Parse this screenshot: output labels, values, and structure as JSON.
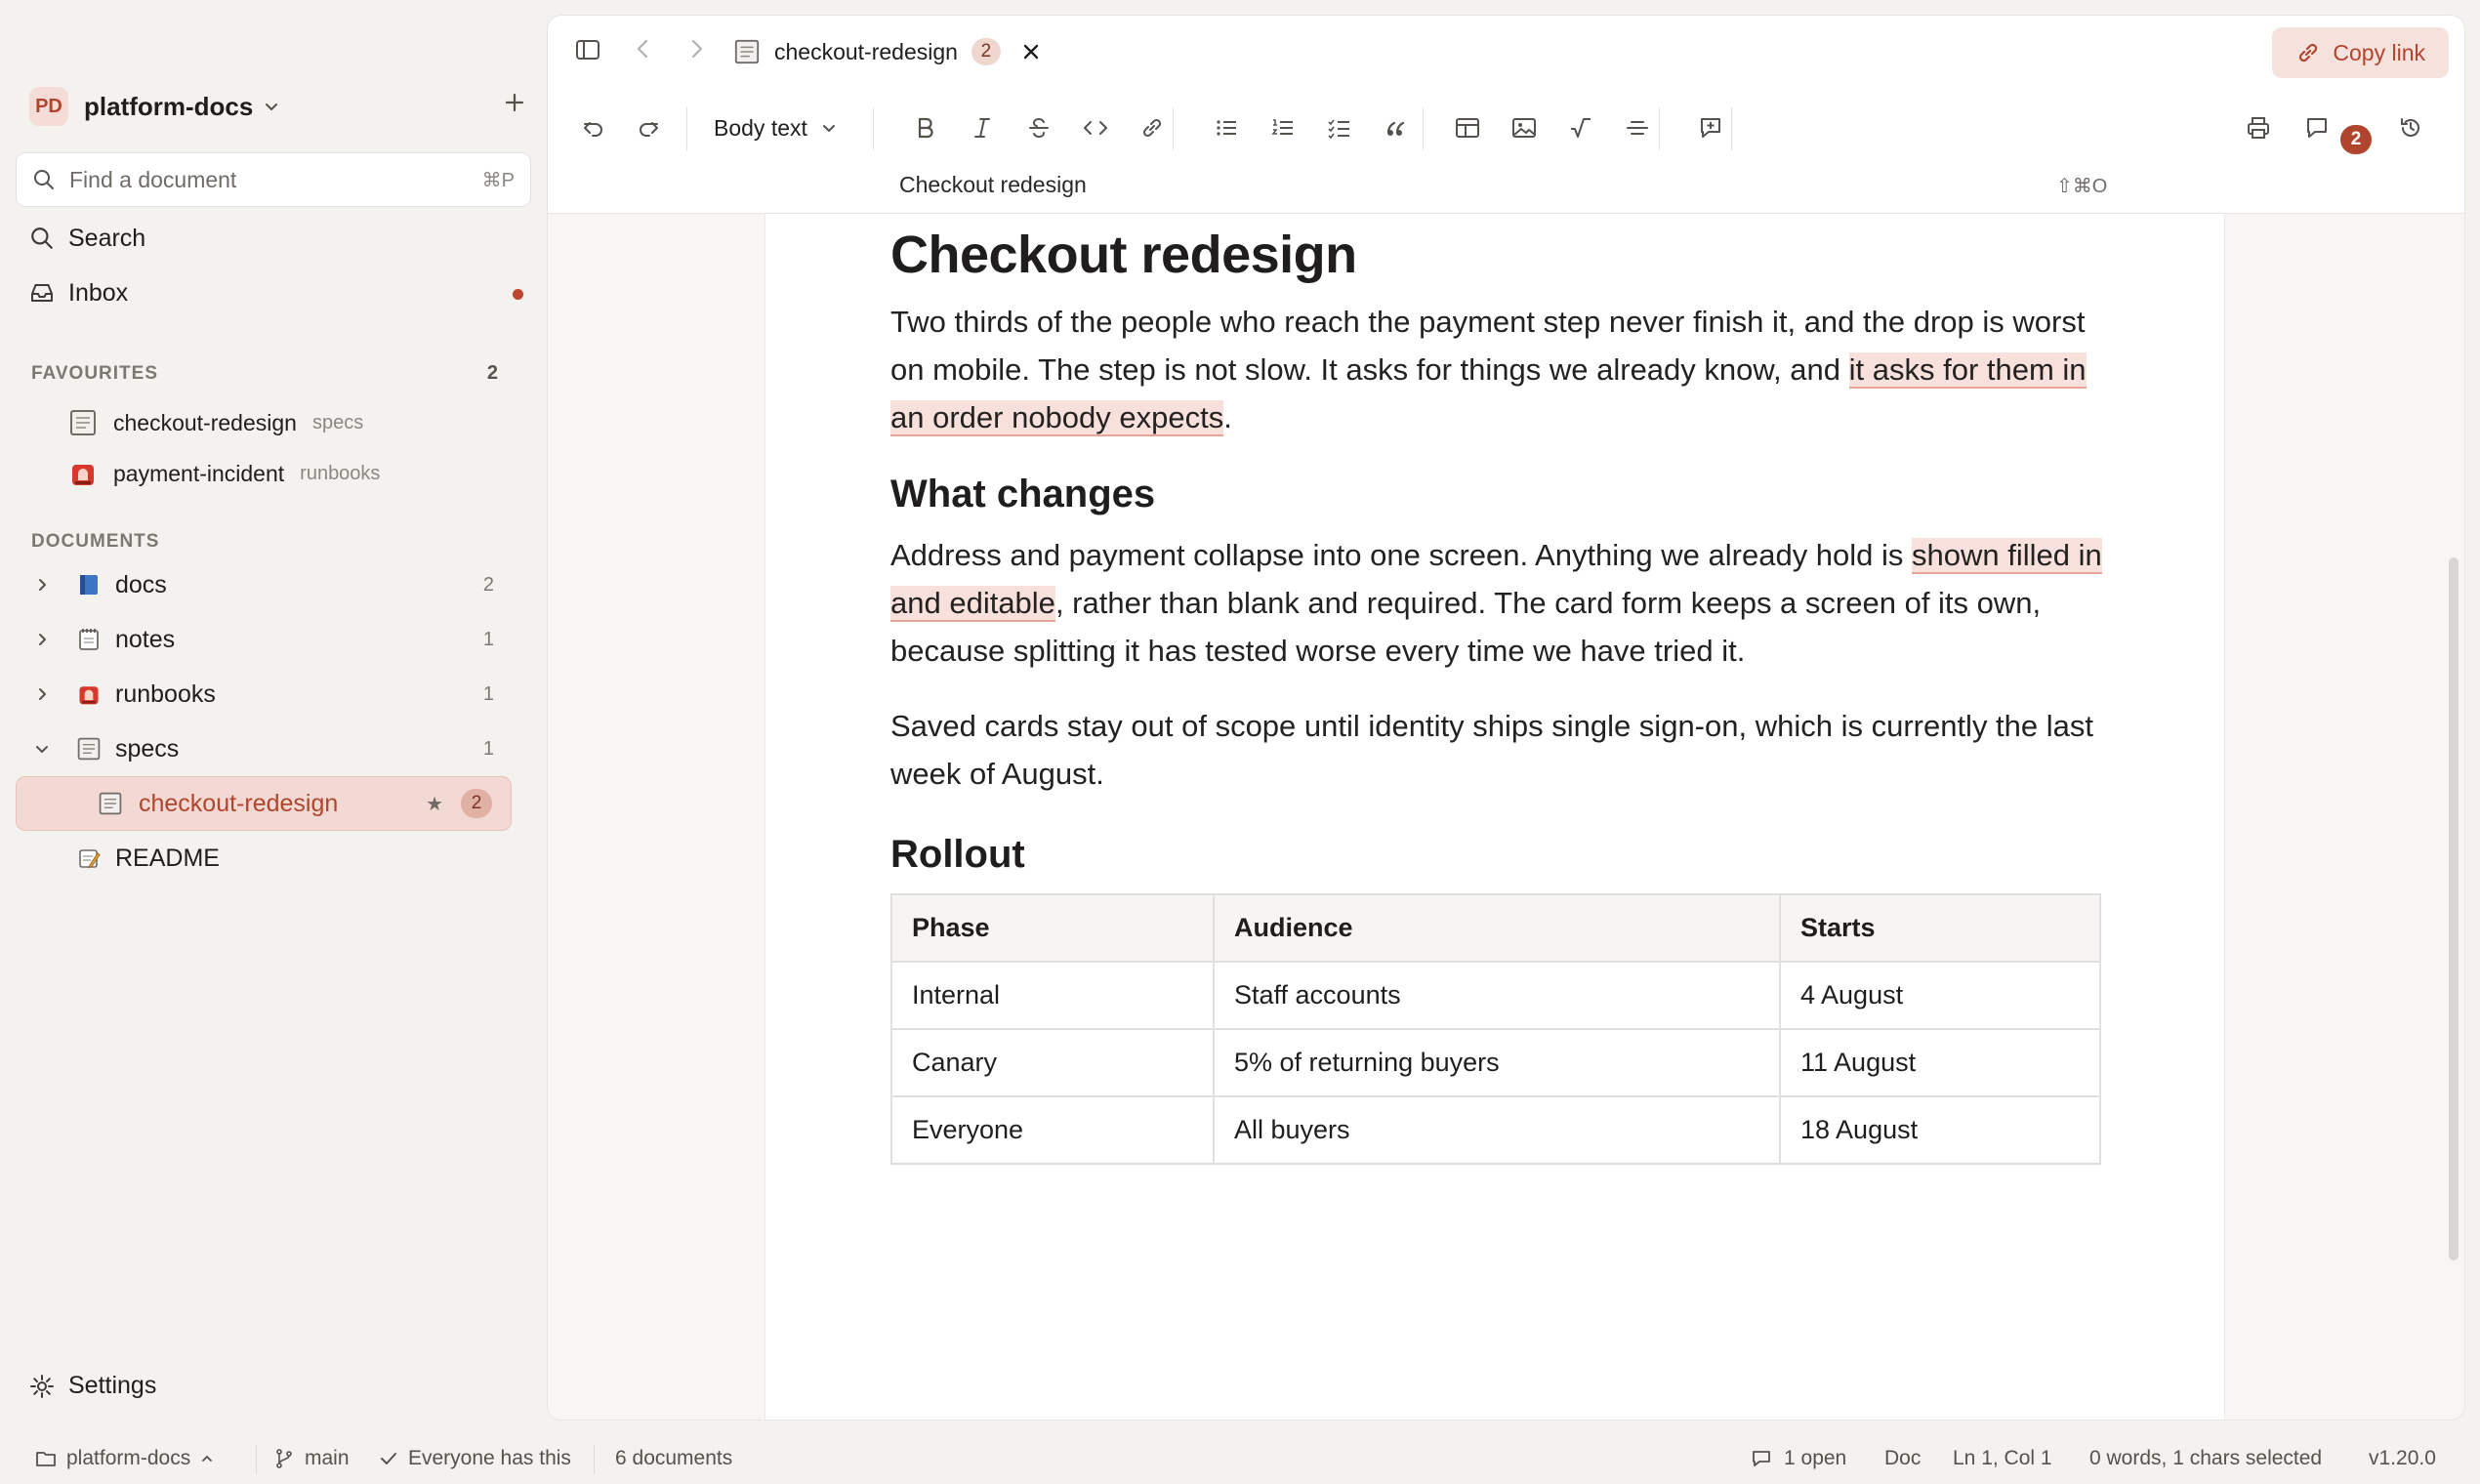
{
  "workspace": {
    "initials": "PD",
    "name": "platform-docs"
  },
  "search_box": {
    "placeholder": "Find a document",
    "shortcut": "⌘P"
  },
  "nav": {
    "search": "Search",
    "inbox": "Inbox"
  },
  "favourites": {
    "heading": "FAVOURITES",
    "count": "2",
    "items": [
      {
        "name": "checkout-redesign",
        "meta": "specs"
      },
      {
        "name": "payment-incident",
        "meta": "runbooks"
      }
    ]
  },
  "documents": {
    "heading": "DOCUMENTS",
    "folders": [
      {
        "name": "docs",
        "count": "2"
      },
      {
        "name": "notes",
        "count": "1"
      },
      {
        "name": "runbooks",
        "count": "1"
      },
      {
        "name": "specs",
        "count": "1"
      }
    ],
    "selected": {
      "name": "checkout-redesign",
      "comments": "2"
    },
    "readme": "README"
  },
  "settings_label": "Settings",
  "tab": {
    "title": "checkout-redesign",
    "badge": "2"
  },
  "copy_link": "Copy link",
  "toolbar": {
    "block_type": "Body text",
    "comments_count": "2"
  },
  "breadcrumb": {
    "title": "Checkout redesign",
    "shortcut": "⇧⌘O"
  },
  "doc": {
    "h1": "Checkout redesign",
    "p1_a": "Two thirds of the people who reach the payment step never finish it, and the drop is worst on mobile. The step is not slow. It asks for things we already know, and ",
    "p1_hl": "it asks for them in an order nobody expects",
    "p1_b": ".",
    "h2_changes": "What changes",
    "p2_a": "Address and payment collapse into one screen. Anything we already hold is ",
    "p2_hl": "shown filled in and editable",
    "p2_b": ", rather than blank and required. The card form keeps a screen of its own, because splitting it has tested worse every time we have tried it.",
    "p3": "Saved cards stay out of scope until identity ships single sign-on, which is currently the last week of August.",
    "h2_rollout": "Rollout",
    "table": {
      "headers": [
        "Phase",
        "Audience",
        "Starts"
      ],
      "rows": [
        [
          "Internal",
          "Staff accounts",
          "4 August"
        ],
        [
          "Canary",
          "5% of returning buyers",
          "11 August"
        ],
        [
          "Everyone",
          "All buyers",
          "18 August"
        ]
      ]
    }
  },
  "status": {
    "workspace": "platform-docs",
    "branch": "main",
    "sharing": "Everyone has this",
    "doc_count": "6 documents",
    "comments": "1 open",
    "mode": "Doc",
    "cursor": "Ln 1, Col 1",
    "selection": "0 words, 1 chars selected",
    "version": "v1.20.0"
  },
  "colors": {
    "accent": "#b0452e",
    "highlight": "#f8e1dc",
    "selected_bg": "#f3d9d3"
  }
}
